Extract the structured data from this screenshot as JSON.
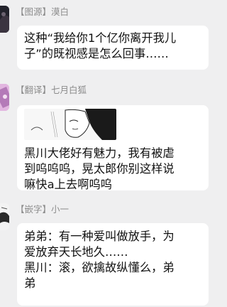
{
  "messages": [
    {
      "sender": "【图源】漠白",
      "lines": [
        "这种“我给你1个亿你离开我儿",
        "子”的既视感是怎么回事……"
      ]
    },
    {
      "sender": "【翻译】七月白狐",
      "sticker": "manga-panel",
      "lines": [
        "黑川大佬好有魅力，我有被虐",
        "到呜呜呜，晃太郎你别这样说",
        "嘛快a上去啊呜呜"
      ]
    },
    {
      "sender": "【嵌字】小一",
      "lines": [
        "弟弟：有一种爱叫做放手，为",
        "爱放弃天长地久……",
        "黑川：滚，欲擒故纵懂么，弟",
        "弟"
      ]
    }
  ],
  "colors": {
    "background": "#efeff0",
    "bubble": "#ffffff",
    "sender_name": "#8c8c8c"
  }
}
